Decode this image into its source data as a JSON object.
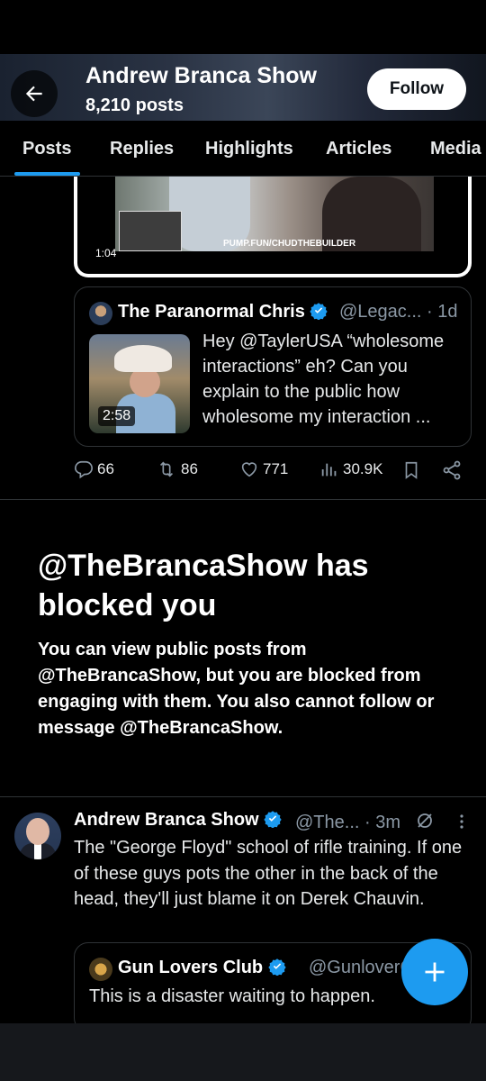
{
  "header": {
    "title": "Andrew Branca Show",
    "post_count": "8,210 posts",
    "follow_label": "Follow"
  },
  "tabs": [
    {
      "label": "Posts",
      "active": true
    },
    {
      "label": "Replies"
    },
    {
      "label": "Highlights"
    },
    {
      "label": "Articles"
    },
    {
      "label": "Media"
    }
  ],
  "video": {
    "duration": "1:04",
    "caption": "PUMP.FUN/CHUDTHEBUILDER"
  },
  "quoted_post": {
    "name": "The Paranormal Chris",
    "handle_time": "@Legac... · 1d",
    "thumb_duration": "2:58",
    "text": "Hey @TaylerUSA “wholesome interactions” eh? Can you explain to the public how wholesome my interaction ..."
  },
  "actions": {
    "replies": "66",
    "reposts": "86",
    "likes": "771",
    "views": "30.9K"
  },
  "blocked": {
    "title": "@TheBrancaShow has blocked you",
    "text": "You can view public posts from @TheBrancaShow, but you are blocked from engaging with them. You also cannot follow or message @TheBrancaShow."
  },
  "post": {
    "name": "Andrew Branca Show",
    "handle_time": "@The... · 3m",
    "text": "The \"George Floyd\" school of rifle training. If one of these guys pots the other in the back of the head, they'll just blame it on Derek Chauvin."
  },
  "quoted_post2": {
    "name": "Gun Lovers Club",
    "handle": "@GunloverCl",
    "text": "This is a disaster waiting to happen."
  },
  "colors": {
    "accent": "#1d9bf0",
    "background": "#000000",
    "muted_text": "#8b98a5",
    "divider": "#2f3336"
  },
  "icons": [
    "back-arrow-icon",
    "verified-badge-icon",
    "reply-icon",
    "repost-icon",
    "like-icon",
    "views-icon",
    "bookmark-icon",
    "share-icon",
    "more-icon",
    "grok-icon",
    "plus-icon"
  ]
}
